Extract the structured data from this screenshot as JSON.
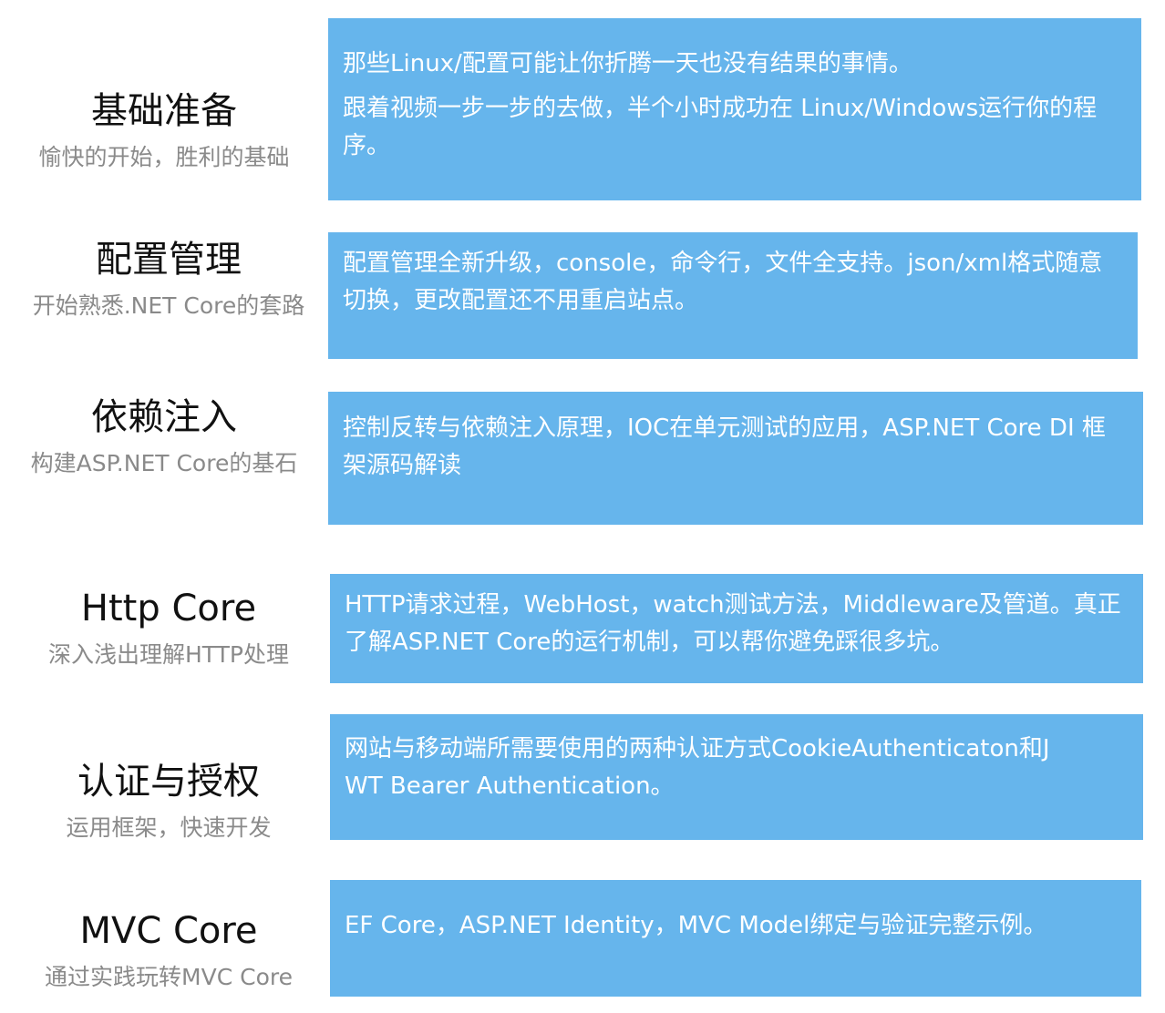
{
  "sections": [
    {
      "title": "基础准备",
      "subtitle": "愉快的开始，胜利的基础",
      "description": [
        "那些Linux/配置可能让你折腾一天也没有结果的事情。",
        "跟着视频一步一步的去做，半个小时成功在 Linux/Windows运行你的程序。"
      ]
    },
    {
      "title": "配置管理",
      "subtitle": "开始熟悉.NET Core的套路",
      "description": [
        "配置管理全新升级，console，命令行，文件全支持。json/xml格式随意切换，更改配置还不用重启站点。"
      ]
    },
    {
      "title": "依赖注入",
      "subtitle": "构建ASP.NET Core的基石",
      "description": [
        "控制反转与依赖注入原理，IOC在单元测试的应用，ASP.NET Core DI 框架源码解读"
      ]
    },
    {
      "title": "Http Core",
      "subtitle": "深入浅出理解HTTP处理",
      "description": [
        "HTTP请求过程，WebHost，watch测试方法，Middleware及管道。真正了解ASP.NET Core的运行机制，可以帮你避免踩很多坑。"
      ]
    },
    {
      "title": "认证与授权",
      "subtitle": "运用框架，快速开发",
      "description": [
        "网站与移动端所需要使用的两种认证方式CookieAuthenticaton和JWT Bearer Authentication。"
      ]
    },
    {
      "title": "MVC Core",
      "subtitle": "通过实践玩转MVC Core",
      "description": [
        "EF Core，ASP.NET Identity，MVC Model绑定与验证完整示例。"
      ]
    }
  ],
  "colors": {
    "box_background": "#66b5ec",
    "box_text": "#ffffff",
    "title_text": "#111111",
    "subtitle_text": "#8a8a8a"
  }
}
